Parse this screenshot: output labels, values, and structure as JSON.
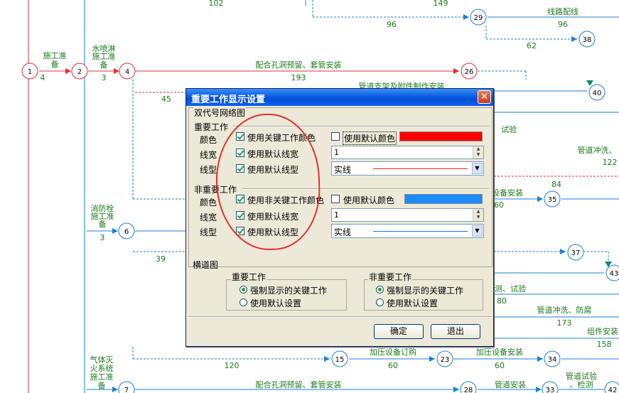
{
  "network": {
    "nodes": [
      {
        "id": "n1",
        "label": "1",
        "color": "red"
      },
      {
        "id": "n2",
        "label": "2",
        "color": "red"
      },
      {
        "id": "n4",
        "label": "4",
        "color": "red"
      },
      {
        "id": "n26",
        "label": "26",
        "color": "red"
      },
      {
        "id": "n6",
        "label": "6",
        "color": "blue"
      },
      {
        "id": "n7",
        "label": "7",
        "color": "blue"
      },
      {
        "id": "n29",
        "label": "29",
        "color": "blue"
      },
      {
        "id": "n38",
        "label": "38",
        "color": "blue"
      },
      {
        "id": "n40",
        "label": "40",
        "color": "blue"
      },
      {
        "id": "n35",
        "label": "35",
        "color": "blue"
      },
      {
        "id": "n37",
        "label": "37",
        "color": "blue"
      },
      {
        "id": "n43",
        "label": "43",
        "color": "blue"
      },
      {
        "id": "n15",
        "label": "15",
        "color": "blue"
      },
      {
        "id": "n23",
        "label": "23",
        "color": "blue"
      },
      {
        "id": "n34",
        "label": "34",
        "color": "blue"
      },
      {
        "id": "n28",
        "label": "28",
        "color": "blue"
      },
      {
        "id": "n33",
        "label": "33",
        "color": "blue"
      },
      {
        "id": "n42",
        "label": "42",
        "color": "blue"
      }
    ],
    "labels": [
      {
        "text": "102"
      },
      {
        "text": "149"
      },
      {
        "text": "线路配线"
      },
      {
        "text": "96"
      },
      {
        "text": "96"
      },
      {
        "text": "62"
      },
      {
        "text": "施工准"
      },
      {
        "text": "备"
      },
      {
        "text": "4"
      },
      {
        "text": "水喷淋"
      },
      {
        "text": "施工准"
      },
      {
        "text": "备"
      },
      {
        "text": "3"
      },
      {
        "text": "配合孔洞预留、套管安装"
      },
      {
        "text": "193"
      },
      {
        "text": "45"
      },
      {
        "text": "管道支架及附件制作安装"
      },
      {
        "text": "试验"
      },
      {
        "text": "管道冲洗、"
      },
      {
        "text": "122"
      },
      {
        "text": "84"
      },
      {
        "text": "设备安装"
      },
      {
        "text": "60"
      },
      {
        "text": "消防栓"
      },
      {
        "text": "施工准"
      },
      {
        "text": "备"
      },
      {
        "text": "3"
      },
      {
        "text": "39"
      },
      {
        "text": "测、试验"
      },
      {
        "text": "80"
      },
      {
        "text": "管道冲洗、防腐"
      },
      {
        "text": "173"
      },
      {
        "text": "组件安装"
      },
      {
        "text": "158"
      },
      {
        "text": "加压设备订购"
      },
      {
        "text": "60"
      },
      {
        "text": "加压设备安装"
      },
      {
        "text": "60"
      },
      {
        "text": "120"
      },
      {
        "text": "气体灭"
      },
      {
        "text": "火系统"
      },
      {
        "text": "施工准"
      },
      {
        "text": "备"
      },
      {
        "text": "配合孔洞预留、套管安装"
      },
      {
        "text": "管道安装"
      },
      {
        "text": "管道试验"
      },
      {
        "text": "、检测"
      }
    ]
  },
  "dialog": {
    "title": "重要工作显示设置",
    "section_double": "双代号网络图",
    "important": {
      "group_label": "重要工作",
      "color_label": "颜色",
      "color_checkbox": "使用关键工作颜色",
      "color_default_checkbox": "使用默认颜色",
      "color_value": "#ff0000",
      "width_label": "线宽",
      "width_checkbox": "使用默认线宽",
      "width_value": "1",
      "style_label": "线型",
      "style_checkbox": "使用默认线型",
      "style_value": "实线",
      "style_color": "#e02020"
    },
    "nonimportant": {
      "group_label": "非重要工作",
      "color_label": "颜色",
      "color_checkbox": "使用非关键工作颜色",
      "color_default_checkbox": "使用默认颜色",
      "color_value": "#1a8cff",
      "width_label": "线宽",
      "width_checkbox": "使用默认线宽",
      "width_value": "1",
      "style_label": "线型",
      "style_checkbox": "使用默认线型",
      "style_value": "实线",
      "style_color": "#1a6fe0"
    },
    "section_bar": "横道图",
    "bar_important": {
      "group_label": "重要工作",
      "option1": "强制显示的关键工作",
      "option2": "使用默认设置",
      "selected": 1
    },
    "bar_nonimportant": {
      "group_label": "非重要工作",
      "option1": "强制显示的关键工作",
      "option2": "使用默认设置",
      "selected": 1
    },
    "ok_label": "确定",
    "cancel_label": "退出"
  }
}
